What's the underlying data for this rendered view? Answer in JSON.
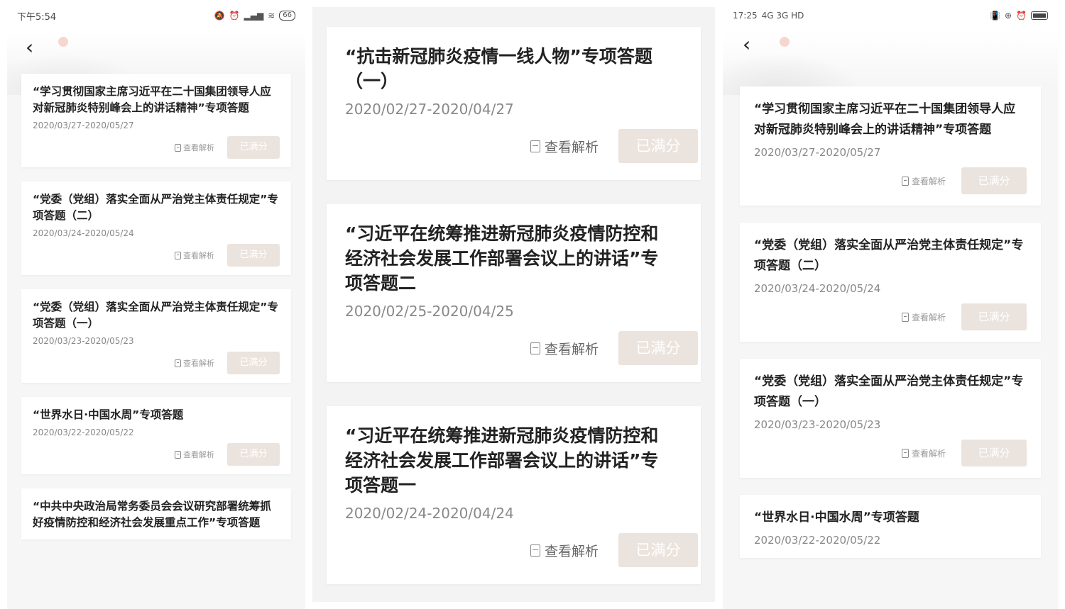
{
  "left": {
    "status": {
      "time": "下午5:54",
      "battery": "66"
    },
    "cards": [
      {
        "title": "“学习贯彻国家主席习近平在二十国集团领导人应对新冠肺炎特别峰会上的讲话精神”专项答题",
        "date": "2020/03/27-2020/05/27",
        "analysis": "查看解析",
        "score": "已满分"
      },
      {
        "title": "“党委（党组）落实全面从严治党主体责任规定”专项答题（二）",
        "date": "2020/03/24-2020/05/24",
        "analysis": "查看解析",
        "score": "已满分"
      },
      {
        "title": "“党委（党组）落实全面从严治党主体责任规定”专项答题（一）",
        "date": "2020/03/23-2020/05/23",
        "analysis": "查看解析",
        "score": "已满分"
      },
      {
        "title": "“世界水日·中国水周”专项答题",
        "date": "2020/03/22-2020/05/22",
        "analysis": "查看解析",
        "score": "已满分"
      },
      {
        "title": "“中共中央政治局常务委员会会议研究部署统筹抓好疫情防控和经济社会发展重点工作”专项答题",
        "date": "",
        "analysis": "",
        "score": ""
      }
    ]
  },
  "mid": {
    "cards": [
      {
        "title": "“抗击新冠肺炎疫情一线人物”专项答题（一）",
        "date": "2020/02/27-2020/04/27",
        "analysis": "查看解析",
        "score": "已满分"
      },
      {
        "title": "“习近平在统筹推进新冠肺炎疫情防控和经济社会发展工作部署会议上的讲话”专项答题二",
        "date": "2020/02/25-2020/04/25",
        "analysis": "查看解析",
        "score": "已满分"
      },
      {
        "title": "“习近平在统筹推进新冠肺炎疫情防控和经济社会发展工作部署会议上的讲话”专项答题一",
        "date": "2020/02/24-2020/04/24",
        "analysis": "查看解析",
        "score": "已满分"
      }
    ]
  },
  "right": {
    "status": {
      "time": "17:25",
      "network": "4G 3G HD"
    },
    "cards": [
      {
        "title": "“学习贯彻国家主席习近平在二十国集团领导人应对新冠肺炎特别峰会上的讲话精神”专项答题",
        "date": "2020/03/27-2020/05/27",
        "analysis": "查看解析",
        "score": "已满分"
      },
      {
        "title": "“党委（党组）落实全面从严治党主体责任规定”专项答题（二）",
        "date": "2020/03/24-2020/05/24",
        "analysis": "查看解析",
        "score": "已满分"
      },
      {
        "title": "“党委（党组）落实全面从严治党主体责任规定”专项答题（一）",
        "date": "2020/03/23-2020/05/23",
        "analysis": "查看解析",
        "score": "已满分"
      },
      {
        "title": "“世界水日·中国水周”专项答题",
        "date": "2020/03/22-2020/05/22",
        "analysis": "",
        "score": ""
      }
    ]
  },
  "colors": {
    "score_button": "#ebe3de",
    "date_text": "#888888",
    "background": "#f6f6f6"
  },
  "icons": {
    "back": "chevron-left-icon",
    "analysis": "document-icon"
  }
}
